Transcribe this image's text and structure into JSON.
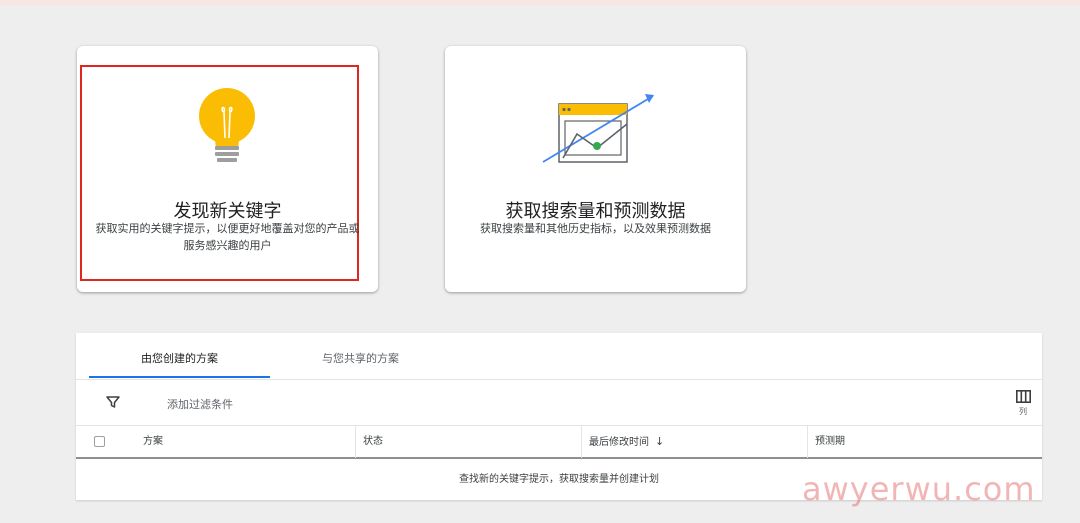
{
  "cards": [
    {
      "title": "发现新关键字",
      "description": "获取实用的关键字提示，以便更好地覆盖对您的产品或服务感兴趣的用户",
      "icon": "lightbulb-icon"
    },
    {
      "title": "获取搜索量和预测数据",
      "description": "获取搜索量和其他历史指标，以及效果预测数据",
      "icon": "trend-chart-icon"
    }
  ],
  "plans": {
    "tabs": [
      {
        "label": "由您创建的方案",
        "active": true
      },
      {
        "label": "与您共享的方案",
        "active": false
      }
    ],
    "filter": {
      "icon": "filter-icon",
      "add_label": "添加过滤条件"
    },
    "columns": {
      "icon": "columns-icon",
      "label": "列"
    },
    "table": {
      "headers": [
        "方案",
        "状态",
        "最后修改时间",
        "预测期"
      ],
      "sort_icon": "↓",
      "empty_message": "查找新的关键字提示，获取搜索量并创建计划"
    }
  },
  "watermark": "awyerwu.com",
  "colors": {
    "accent": "#1a73e8",
    "highlight_border": "#e0271f",
    "bulb": "#fbbc04",
    "chart_green": "#34a853",
    "chart_arrow": "#4285f4"
  }
}
